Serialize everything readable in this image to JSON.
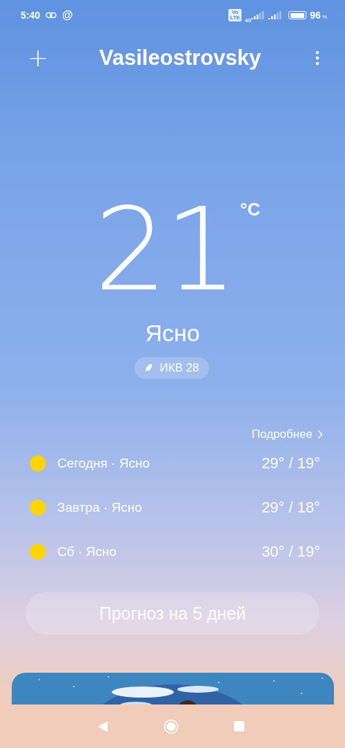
{
  "status_bar": {
    "time": "5:40",
    "at_sign": "@",
    "volte": [
      "Vo",
      "LTE"
    ],
    "network": "4G",
    "battery": "96",
    "battery_unit": "%"
  },
  "header": {
    "add": "+",
    "title": "Vasileostrovsky"
  },
  "current": {
    "temperature": "21",
    "unit": "°C",
    "condition": "Ясно",
    "aqi": "ИКВ 28"
  },
  "forecast": {
    "more": "Подробнее",
    "days": [
      {
        "label": "Сегодня · Ясно",
        "temps": "29° / 19°"
      },
      {
        "label": "Завтра · Ясно",
        "temps": "29° / 18°"
      },
      {
        "label": "Сб · Ясно",
        "temps": "30° / 19°"
      }
    ],
    "button": "Прогноз на 5 дней"
  }
}
